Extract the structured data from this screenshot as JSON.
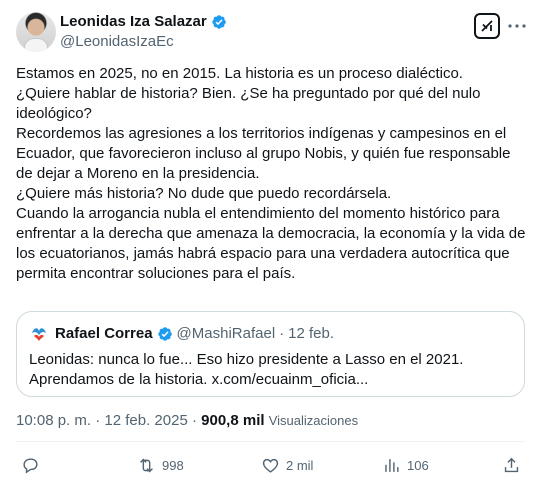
{
  "author": {
    "display_name": "Leonidas Iza Salazar",
    "handle": "@LeonidasIzaEc",
    "verified": true
  },
  "header": {
    "grok_icon": "grok-icon",
    "more_icon": "more-options-icon"
  },
  "tweet": {
    "lines": [
      "Estamos en 2025, no en 2015. La historia es un proceso dialéctico.",
      "¿Quiere hablar de historia? Bien. ¿Se ha preguntado por qué del nulo ideológico?",
      "Recordemos las agresiones a los territorios indígenas y campesinos en el Ecuador, que favorecieron incluso al grupo Nobis, y quién fue responsable de dejar a Moreno en la presidencia.",
      "¿Quiere más historia? No dude que puedo recordársela.",
      "Cuando la arrogancia nubla el entendimiento del momento histórico para enfrentar a la derecha que amenaza la democracia, la economía y la vida de los ecuatorianos, jamás habrá espacio para una verdadera autocrítica que permita encontrar soluciones para el país."
    ]
  },
  "quote": {
    "display_name": "Rafael Correa",
    "handle": "@MashiRafael",
    "separator": "·",
    "date": "12 feb.",
    "line1": "Leonidas: nunca lo fue... Eso hizo presidente a Lasso en el 2021.",
    "line2": "Aprendamos de la historia. x.com/ecuainm_oficia..."
  },
  "meta": {
    "time": "10:08 p. m.",
    "dot": "·",
    "date": "12 feb. 2025",
    "views_count": "900,8 mil",
    "views_label": "Visualizaciones"
  },
  "actions": {
    "reply_icon": "reply-icon",
    "retweet_count": "998",
    "like_count": "2 mil",
    "bookmark_count": "106",
    "share_icon": "share-icon"
  },
  "colors": {
    "text": "#0f1419",
    "secondary": "#536471",
    "verified": "#1d9bf0",
    "border": "#cfd9de"
  }
}
